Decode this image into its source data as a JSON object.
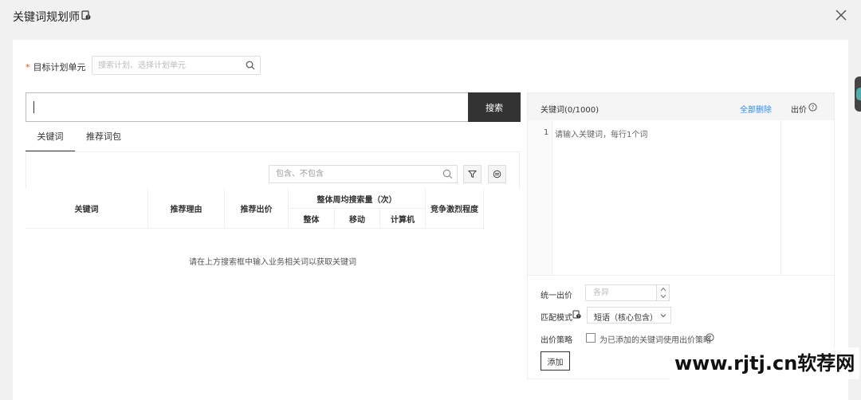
{
  "window": {
    "title": "关键词规划师",
    "title_icon": "doc-help-icon",
    "close_icon": "close-icon"
  },
  "unit_selector": {
    "required_mark": "*",
    "label": "目标计划单元",
    "placeholder": "搜索计划、选择计划单元"
  },
  "search": {
    "value": "",
    "button_label": "搜索"
  },
  "tabs": [
    {
      "label": "关键词",
      "active": true
    },
    {
      "label": "推荐词包",
      "active": false
    }
  ],
  "filter": {
    "placeholder": "包含、不包含"
  },
  "table": {
    "headers": {
      "keyword": "关键词",
      "reason": "推荐理由",
      "bid": "推荐出价",
      "volume_group": "整体周均搜索量（次）",
      "volume_total": "整体",
      "volume_mobile": "移动",
      "volume_pc": "计算机",
      "competition": "竞争激烈程度"
    },
    "empty_message": "请在上方搜索框中输入业务相关词以获取关键词"
  },
  "right_panel": {
    "title": "关键词(0/1000)",
    "clear_all": "全部删除",
    "bid_header": "出价",
    "line_number": "1",
    "textarea_placeholder": "请输入关键词，每行1个词",
    "uniform_bid_label": "统一出价",
    "uniform_bid_placeholder": "各异",
    "match_mode_label": "匹配模式",
    "match_mode_value": "短语（核心包含）",
    "strategy_label": "出价策略",
    "strategy_text": "为已添加的关键词使用出价策略",
    "strategy_checked": false,
    "add_button": "添加"
  },
  "watermark": "www.rjtj.cn软荐网",
  "colors": {
    "accent_link": "#2f8df4",
    "dark_button": "#333333",
    "required": "#e8541e"
  }
}
